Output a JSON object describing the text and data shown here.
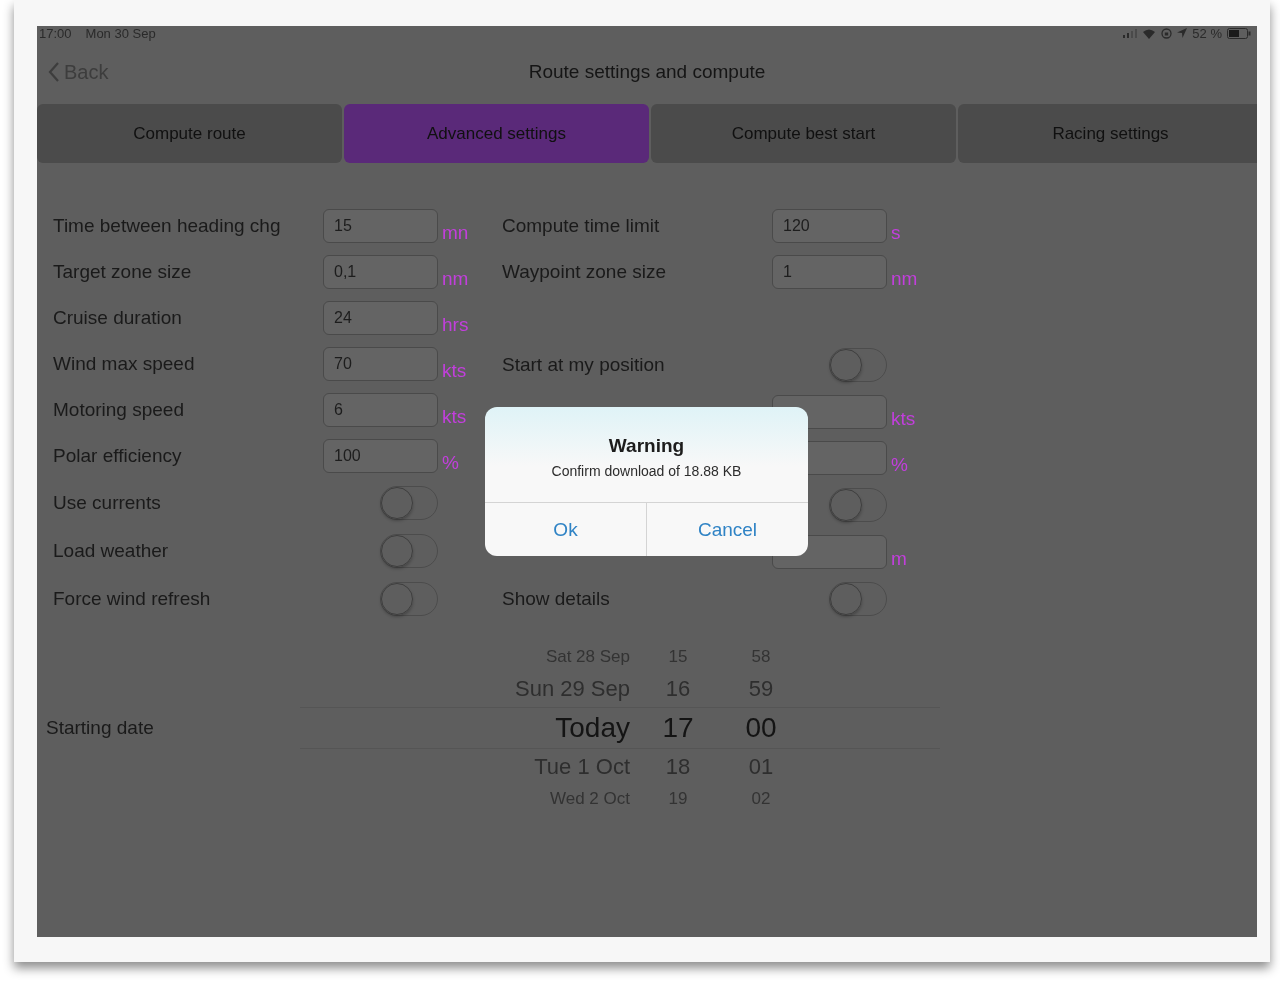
{
  "status_bar": {
    "time": "17:00",
    "date": "Mon 30 Sep",
    "battery": "52 %"
  },
  "nav": {
    "back": "Back",
    "title": "Route settings and compute"
  },
  "tabs": [
    {
      "label": "Compute route",
      "selected": false
    },
    {
      "label": "Advanced settings",
      "selected": true
    },
    {
      "label": "Compute best start",
      "selected": false
    },
    {
      "label": "Racing settings",
      "selected": false
    }
  ],
  "left_settings": [
    {
      "kind": "field",
      "label": "Time between heading chg",
      "value": "15",
      "unit": "mn"
    },
    {
      "kind": "field",
      "label": "Target zone size",
      "value": "0,1",
      "unit": "nm"
    },
    {
      "kind": "field",
      "label": "Cruise duration",
      "value": "24",
      "unit": "hrs"
    },
    {
      "kind": "field",
      "label": "Wind max speed",
      "value": "70",
      "unit": "kts"
    },
    {
      "kind": "field",
      "label": "Motoring speed",
      "value": "6",
      "unit": "kts"
    },
    {
      "kind": "field",
      "label": "Polar efficiency",
      "value": "100",
      "unit": "%"
    },
    {
      "kind": "toggle",
      "label": "Use currents",
      "on": false
    },
    {
      "kind": "toggle",
      "label": "Load weather",
      "on": false
    },
    {
      "kind": "toggle",
      "label": "Force wind refresh",
      "on": false
    }
  ],
  "right_settings": [
    {
      "kind": "field",
      "label": "Compute time limit",
      "value": "120",
      "unit": "s"
    },
    {
      "kind": "field",
      "label": "Waypoint zone size",
      "value": "1",
      "unit": "nm"
    },
    {
      "kind": "empty"
    },
    {
      "kind": "toggle",
      "label": "Start at my position",
      "on": false
    },
    {
      "kind": "field",
      "unit": "kts"
    },
    {
      "kind": "field",
      "unit": "%"
    },
    {
      "kind": "toggle",
      "on": false
    },
    {
      "kind": "field",
      "unit": "m"
    },
    {
      "kind": "toggle",
      "label": "Show details",
      "on": false
    }
  ],
  "starting_date": {
    "label": "Starting date",
    "rows": [
      {
        "day": "Sat 28 Sep",
        "hour": "15",
        "minute": "58",
        "selected": false
      },
      {
        "day": "Sun 29 Sep",
        "hour": "16",
        "minute": "59",
        "selected": false
      },
      {
        "day": "Today",
        "hour": "17",
        "minute": "00",
        "selected": true
      },
      {
        "day": "Tue 1 Oct",
        "hour": "18",
        "minute": "01",
        "selected": false
      },
      {
        "day": "Wed 2 Oct",
        "hour": "19",
        "minute": "02",
        "selected": false
      }
    ]
  },
  "dialog": {
    "title": "Warning",
    "message": "Confirm download of 18.88 KB",
    "buttons": [
      "Ok",
      "Cancel"
    ]
  }
}
